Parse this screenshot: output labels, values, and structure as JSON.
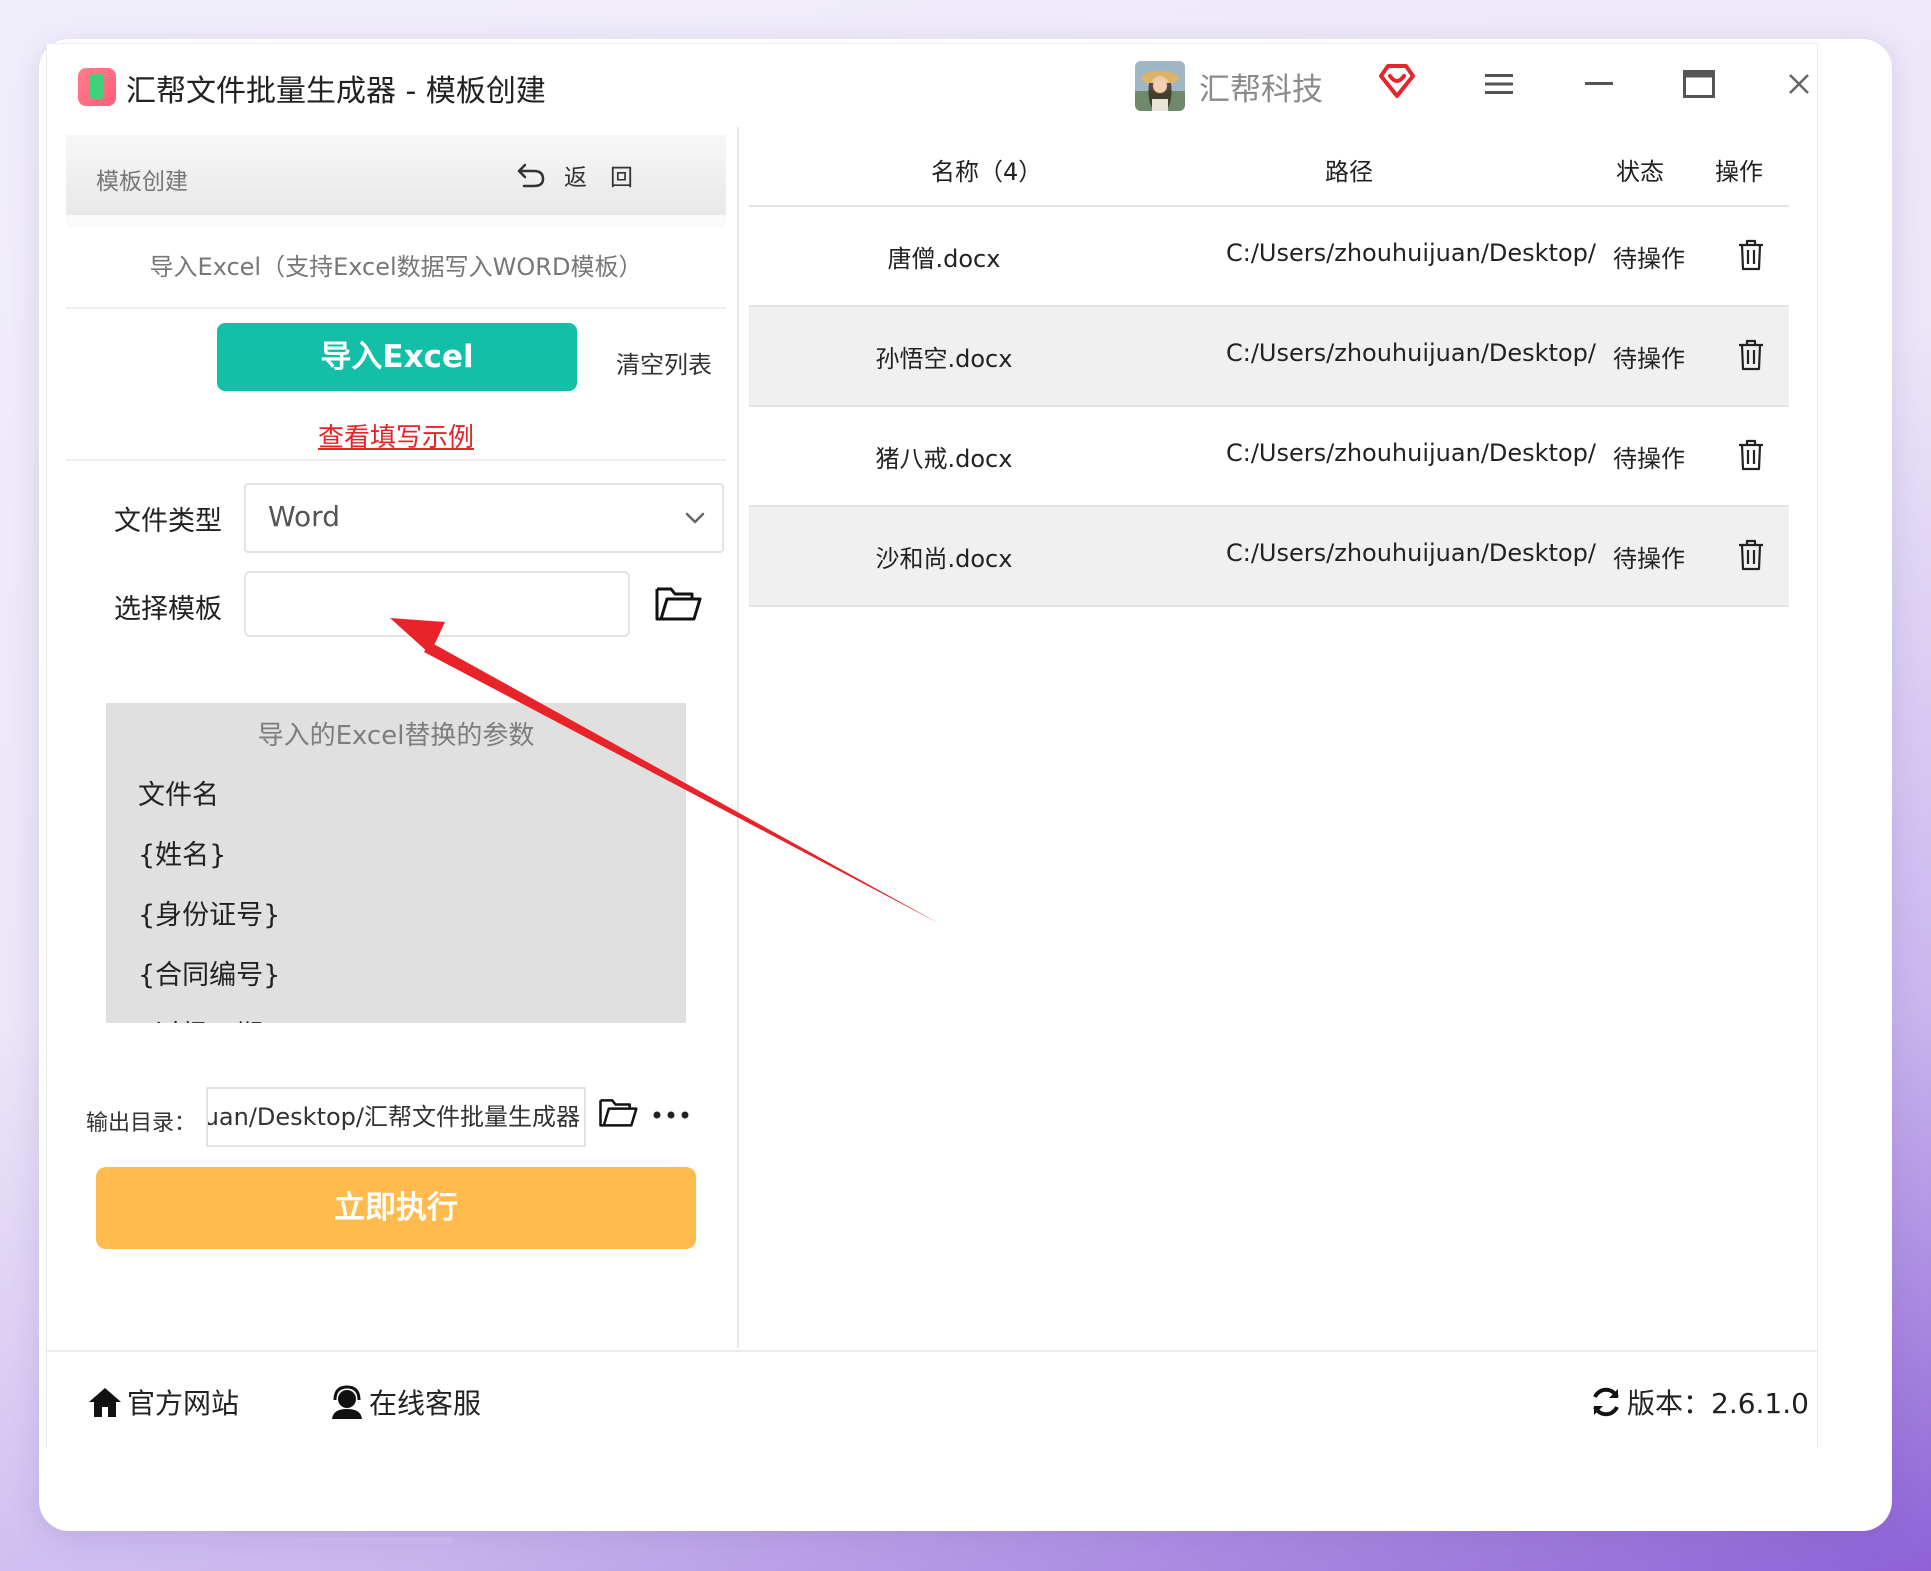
{
  "window": {
    "title": "汇帮文件批量生成器 - 模板创建"
  },
  "header": {
    "brand": "汇帮科技",
    "vip_icon": "diamond-heart-icon"
  },
  "panel": {
    "title": "模板创建",
    "back_label": "返　回",
    "import_hint": "导入Excel（支持Excel数据写入WORD模板）",
    "import_button": "导入Excel",
    "clear_label": "清空列表",
    "example_link": "查看填写示例",
    "file_type_label": "文件类型",
    "file_type_value": "Word",
    "template_label": "选择模板",
    "template_value": "",
    "params_title": "导入的Excel替换的参数",
    "params": [
      "文件名",
      "{姓名}",
      "{身份证号}",
      "{合同编号}",
      "{过场日期}"
    ],
    "output_label": "输出目录：",
    "output_value": "C:/Users/zhouhuijuan/Desktop/汇帮文件批量生成器",
    "run_button": "立即执行"
  },
  "table": {
    "headers": {
      "name": "名称（4）",
      "path": "路径",
      "status": "状态",
      "action": "操作"
    },
    "rows": [
      {
        "name": "唐僧.docx",
        "path": "C:/Users/zhouhuijuan/Desktop/",
        "status": "待操作"
      },
      {
        "name": "孙悟空.docx",
        "path": "C:/Users/zhouhuijuan/Desktop/",
        "status": "待操作"
      },
      {
        "name": "猪八戒.docx",
        "path": "C:/Users/zhouhuijuan/Desktop/",
        "status": "待操作"
      },
      {
        "name": "沙和尚.docx",
        "path": "C:/Users/zhouhuijuan/Desktop/",
        "status": "待操作"
      }
    ]
  },
  "footer": {
    "website": "官方网站",
    "support": "在线客服",
    "version": "版本：2.6.1.0"
  },
  "colors": {
    "import_green": "#14bfa8",
    "run_orange": "#ffbb4e",
    "link_red": "#e8232a",
    "annotation_arrow": "#e8232a"
  }
}
